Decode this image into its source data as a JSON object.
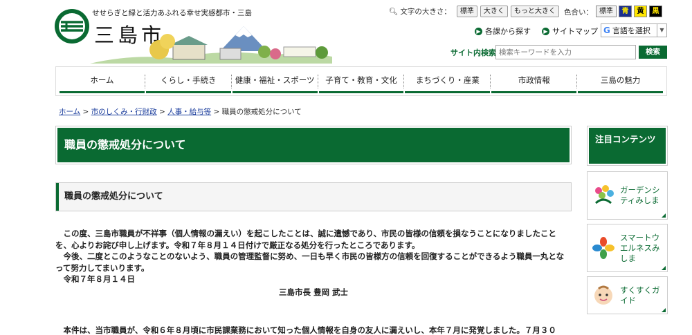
{
  "header": {
    "tagline": "せせらぎと緑と活力あふれる幸せ実感都市・三島",
    "city_name": "三島市",
    "font_size_label": "文字の大きさ",
    "font_sizes": [
      "標準",
      "大きく",
      "もっと大きく"
    ],
    "color_label": "色合い",
    "colors": [
      {
        "label": "標準",
        "bg": "#f2f2f2"
      },
      {
        "label": "青",
        "bg": "#1a2f8f"
      },
      {
        "label": "黄",
        "bg": "#ffe600"
      },
      {
        "label": "黒",
        "bg": "#000000"
      }
    ],
    "links": [
      "各課から探す",
      "サイトマップ"
    ],
    "translate_label": "言語を選択",
    "search_label": "サイト内検索",
    "search_placeholder": "検索キーワードを入力",
    "search_button": "検索"
  },
  "nav": {
    "items": [
      "ホーム",
      "くらし・手続き",
      "健康・福祉・スポーツ",
      "子育て・教育・文化",
      "まちづくり・産業",
      "市政情報",
      "三島の魅力"
    ]
  },
  "breadcrumb": {
    "items": [
      "ホーム",
      "市のしくみ・行財政",
      "人事・給与等"
    ],
    "current": "職員の懲戒処分について",
    "separator": ">"
  },
  "main": {
    "page_title": "職員の懲戒処分について",
    "section_title": "職員の懲戒処分について",
    "paragraph1": "この度、三島市職員が不祥事（個人情報の漏えい）を起こしたことは、誠に遺憾であり、市民の皆様の信頼を損なうことになりましたことを、心よりお詫び申し上げます。令和７年８月１４日付けで厳正なる処分を行ったところであります。",
    "paragraph2": "今後、二度とこのようなことのないよう、職員の管理監督に努め、一日も早く市民の皆様方の信頼を回復することができるよう職員一丸となって努力してまいります。",
    "date": "令和７年８月１４日",
    "signature": "三島市長 豊岡 武士",
    "paragraph3": "本件は、当市職員が、令和６年８月頃に市民課業務において知った個人情報を自身の友人に漏えいし、本年７月に発覚しました。７月３０"
  },
  "side": {
    "title": "注目コンテンツ",
    "cards": [
      {
        "label": "ガーデンシティみしま"
      },
      {
        "label": "スマートウエルネスみしま"
      },
      {
        "label": "すくすくガイド"
      }
    ]
  },
  "colors": {
    "accent": "#0a6a32",
    "link": "#1a3c9c"
  }
}
